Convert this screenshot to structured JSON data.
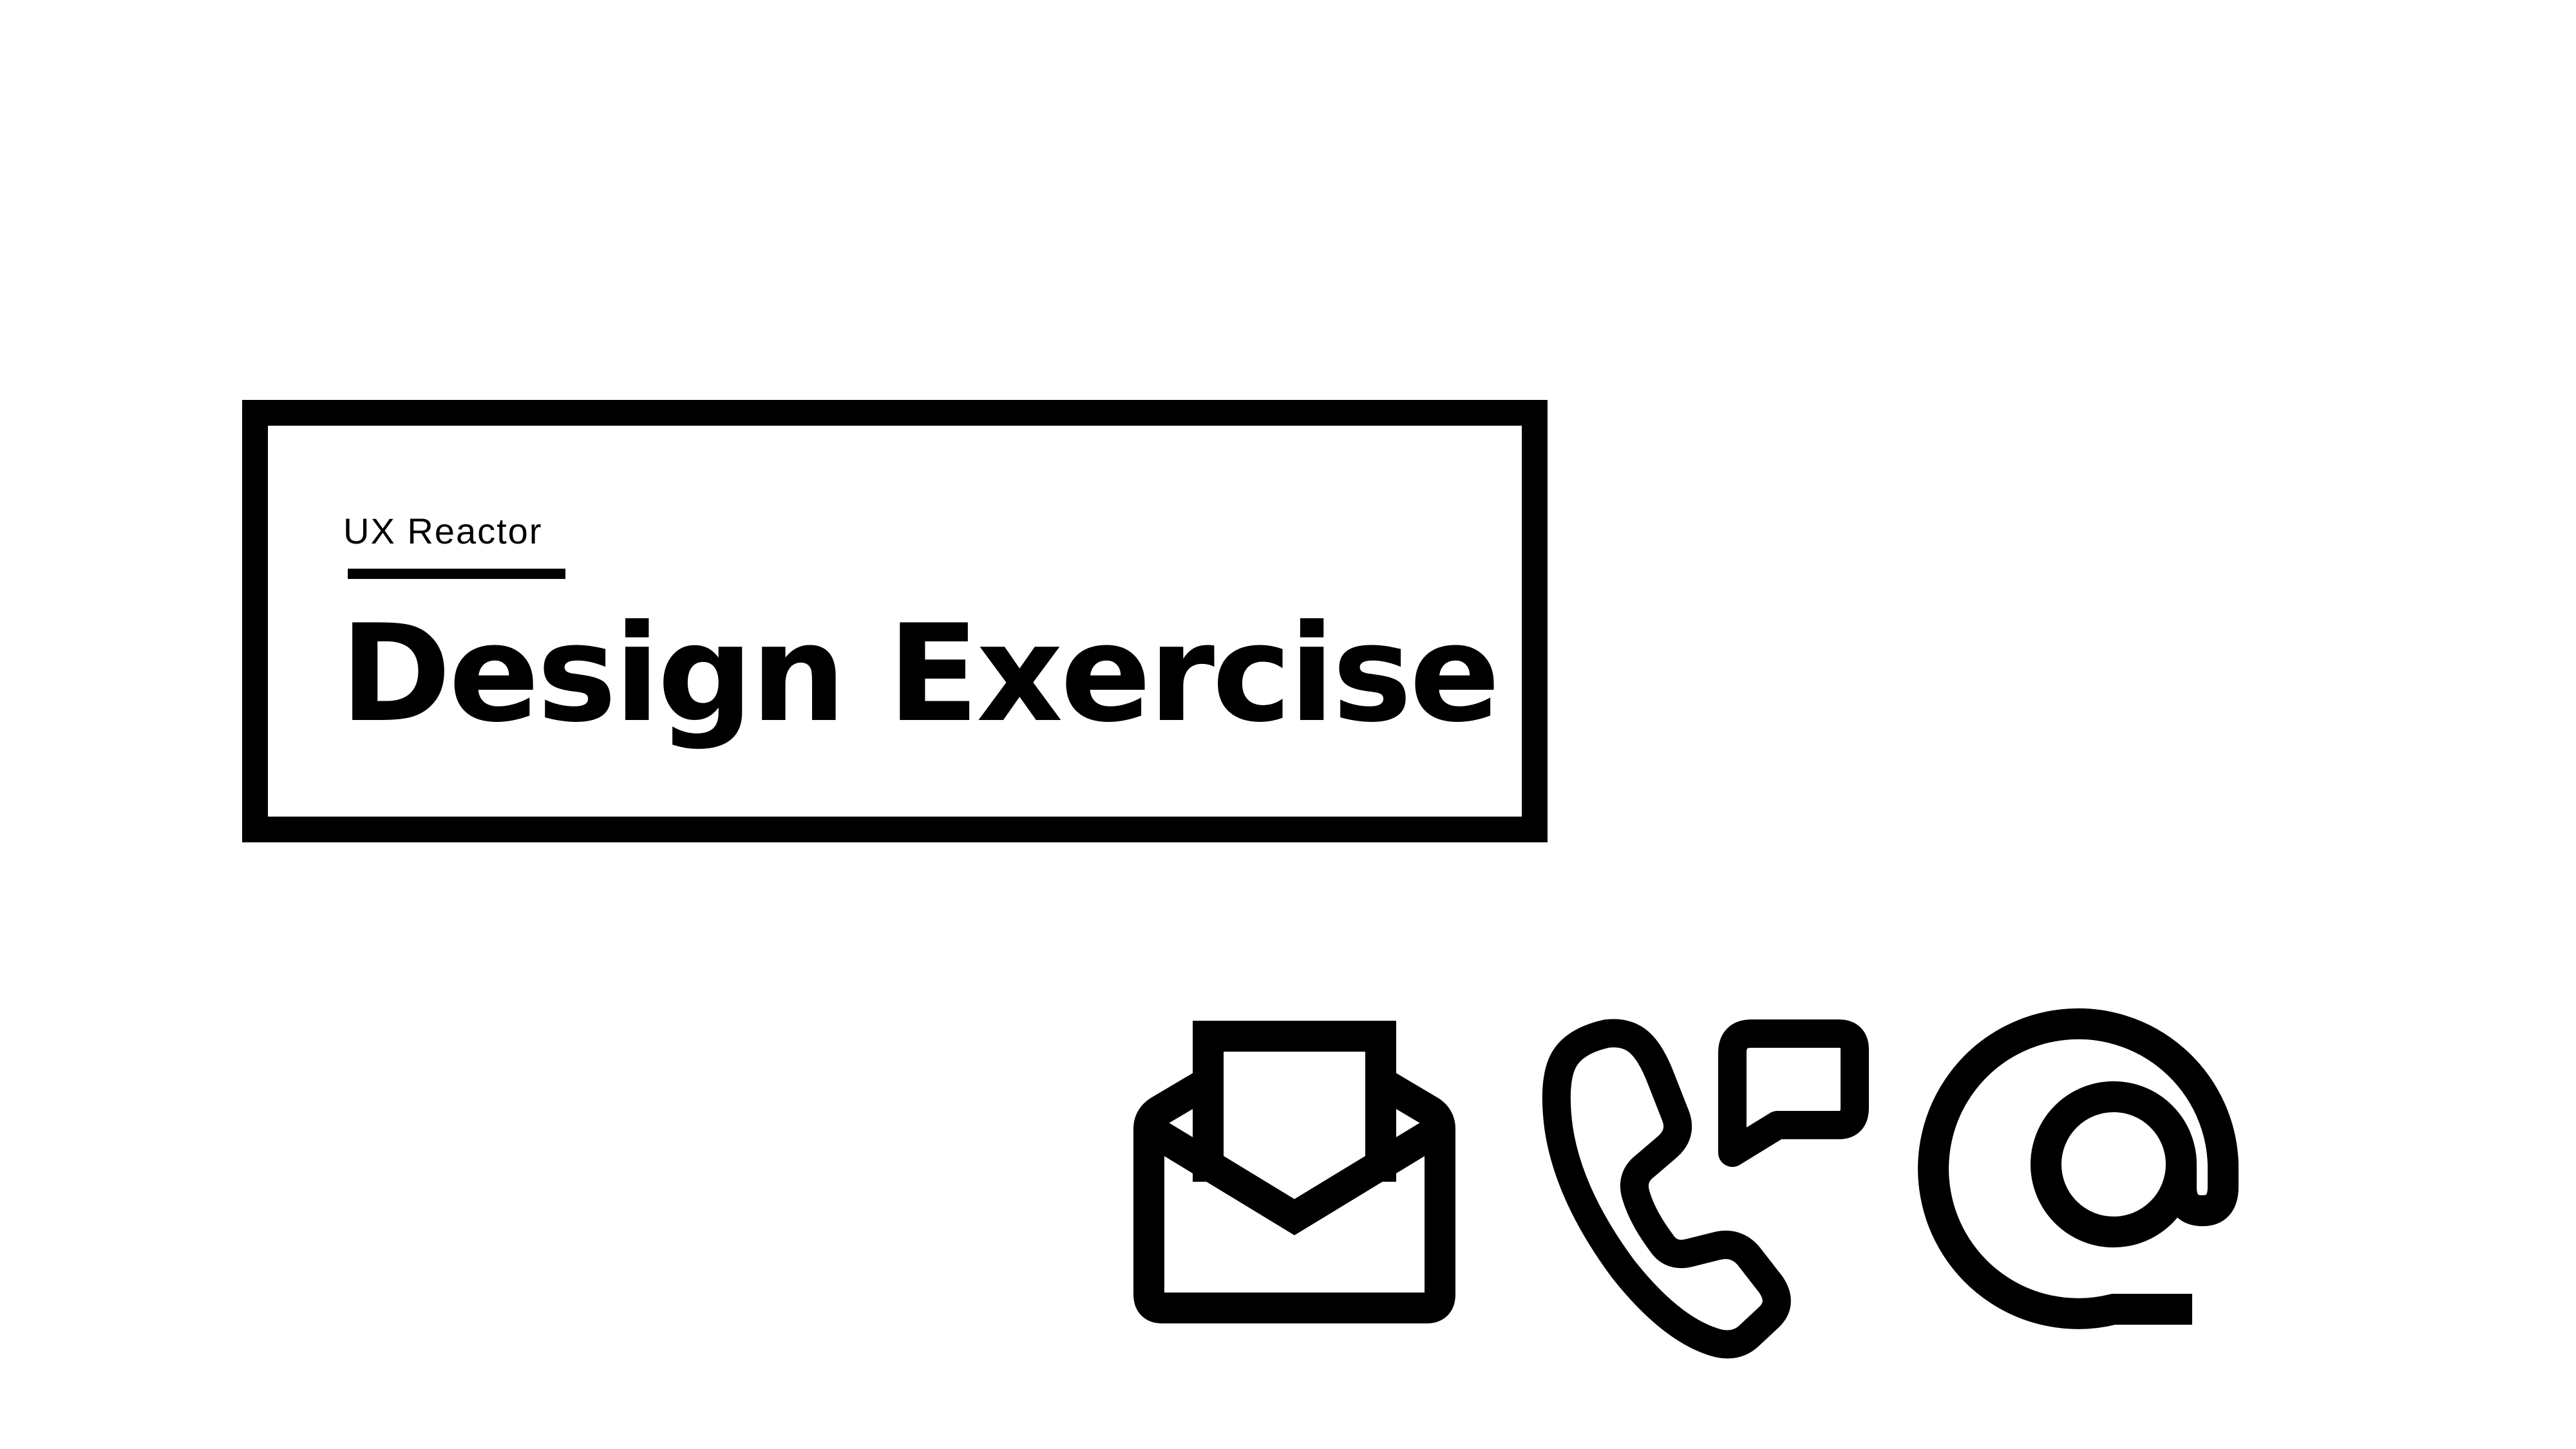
{
  "slide": {
    "subtitle": "UX Reactor",
    "title": "Design Exercise"
  },
  "icons": [
    {
      "name": "open-envelope-icon"
    },
    {
      "name": "phone-chat-icon"
    },
    {
      "name": "at-sign-icon"
    }
  ],
  "colors": {
    "background": "#ffffff",
    "ink": "#000000"
  }
}
